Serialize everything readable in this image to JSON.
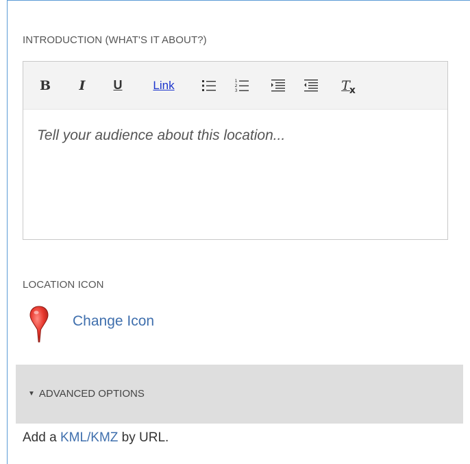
{
  "intro_section": {
    "label": "INTRODUCTION (WHAT'S IT ABOUT?)",
    "toolbar": {
      "bold": "B",
      "italic": "I",
      "underline": "U",
      "link": "Link",
      "bulleted_list_icon": "bulleted-list-icon",
      "numbered_list_icon": "numbered-list-icon",
      "indent_icon": "indent-icon",
      "outdent_icon": "outdent-icon",
      "clear_format": "T",
      "clear_format_x": "x"
    },
    "placeholder": "Tell your audience about this location..."
  },
  "location_icon_section": {
    "label": "LOCATION ICON",
    "change_label": "Change Icon",
    "pin_color": "#e8392f"
  },
  "advanced": {
    "label": "ADVANCED OPTIONS"
  },
  "kml": {
    "prefix": "Add a ",
    "link": "KML/KMZ",
    "suffix": " by URL."
  }
}
